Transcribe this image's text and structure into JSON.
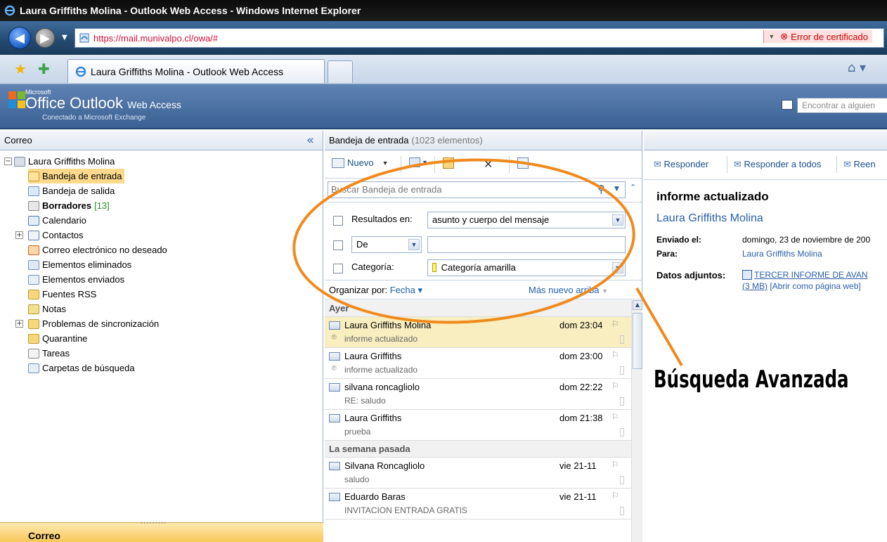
{
  "browser": {
    "window_title": "Laura Griffiths Molina - Outlook Web Access - Windows Internet Explorer",
    "url": "https://mail.munivalpo.cl/owa/#",
    "cert_error": "Error de certificado",
    "tab_label": "Laura Griffiths Molina - Outlook Web Access"
  },
  "owa": {
    "brand_small": "Microsoft",
    "brand_product": "Office Outlook",
    "brand_suffix": "Web Access",
    "connected": "Conectado a Microsoft Exchange",
    "find_placeholder": "Encontrar a alguien"
  },
  "left": {
    "header": "Correo",
    "collapse_glyph": "«",
    "root": "Laura Griffiths Molina",
    "folders": [
      {
        "label": "Bandeja de entrada"
      },
      {
        "label": "Bandeja de salida"
      },
      {
        "label": "Borradores",
        "count": "[13]"
      },
      {
        "label": "Calendario"
      },
      {
        "label": "Contactos"
      },
      {
        "label": "Correo electrónico no deseado"
      },
      {
        "label": "Elementos eliminados"
      },
      {
        "label": "Elementos enviados"
      },
      {
        "label": "Fuentes RSS"
      },
      {
        "label": "Notas"
      },
      {
        "label": "Problemas de sincronización"
      },
      {
        "label": "Quarantine"
      },
      {
        "label": "Tareas"
      },
      {
        "label": "Carpetas de búsqueda"
      }
    ],
    "bottom_label": "Correo"
  },
  "middle": {
    "folder_title": "Bandeja de entrada",
    "item_count": "(1023 elementos)",
    "new_label": "Nuevo",
    "search_placeholder": "Buscar Bandeja de entrada",
    "adv": {
      "results_in_label": "Resultados en:",
      "results_in_value": "asunto y cuerpo del mensaje",
      "from_value": "De",
      "from_input": "",
      "category_label": "Categoría:",
      "category_value": "Categoría amarilla"
    },
    "arrange_label": "Organizar por:",
    "arrange_value": "Fecha",
    "sort_order": "Más nuevo arriba",
    "groups": [
      {
        "name": "Ayer",
        "messages": [
          {
            "from": "Laura Griffiths Molina",
            "subject": "informe actualizado",
            "date": "dom 23:04",
            "attachment": true,
            "selected": true
          },
          {
            "from": "Laura Griffiths",
            "subject": "informe actualizado",
            "date": "dom 23:00",
            "attachment": true
          },
          {
            "from": "silvana roncagliolo",
            "subject": "RE: saludo",
            "date": "dom 22:22"
          },
          {
            "from": "Laura Griffiths",
            "subject": "prueba",
            "date": "dom 21:38"
          }
        ]
      },
      {
        "name": "La semana pasada",
        "messages": [
          {
            "from": "Silvana Roncagliolo",
            "subject": "saludo",
            "date": "vie 21-11"
          },
          {
            "from": "Eduardo Baras",
            "subject": "INVITACION ENTRADA GRATIS",
            "date": "vie 21-11"
          }
        ]
      }
    ]
  },
  "reading": {
    "reply": "Responder",
    "reply_all": "Responder a todos",
    "forward_partial": "Reen",
    "subject": "informe actualizado",
    "from": "Laura Griffiths Molina",
    "sent_label": "Enviado el:",
    "sent_value": "domingo, 23 de noviembre de 200",
    "to_label": "Para:",
    "to_value": "Laura Griffiths Molina",
    "attach_label": "Datos adjuntos:",
    "attach_name": "TERCER INFORME DE AVAN",
    "attach_size": "(3 MB)",
    "attach_open": "[Abrir como página web]"
  },
  "annotation": {
    "callout": "Búsqueda Avanzada",
    "color": "#f08a1c"
  }
}
